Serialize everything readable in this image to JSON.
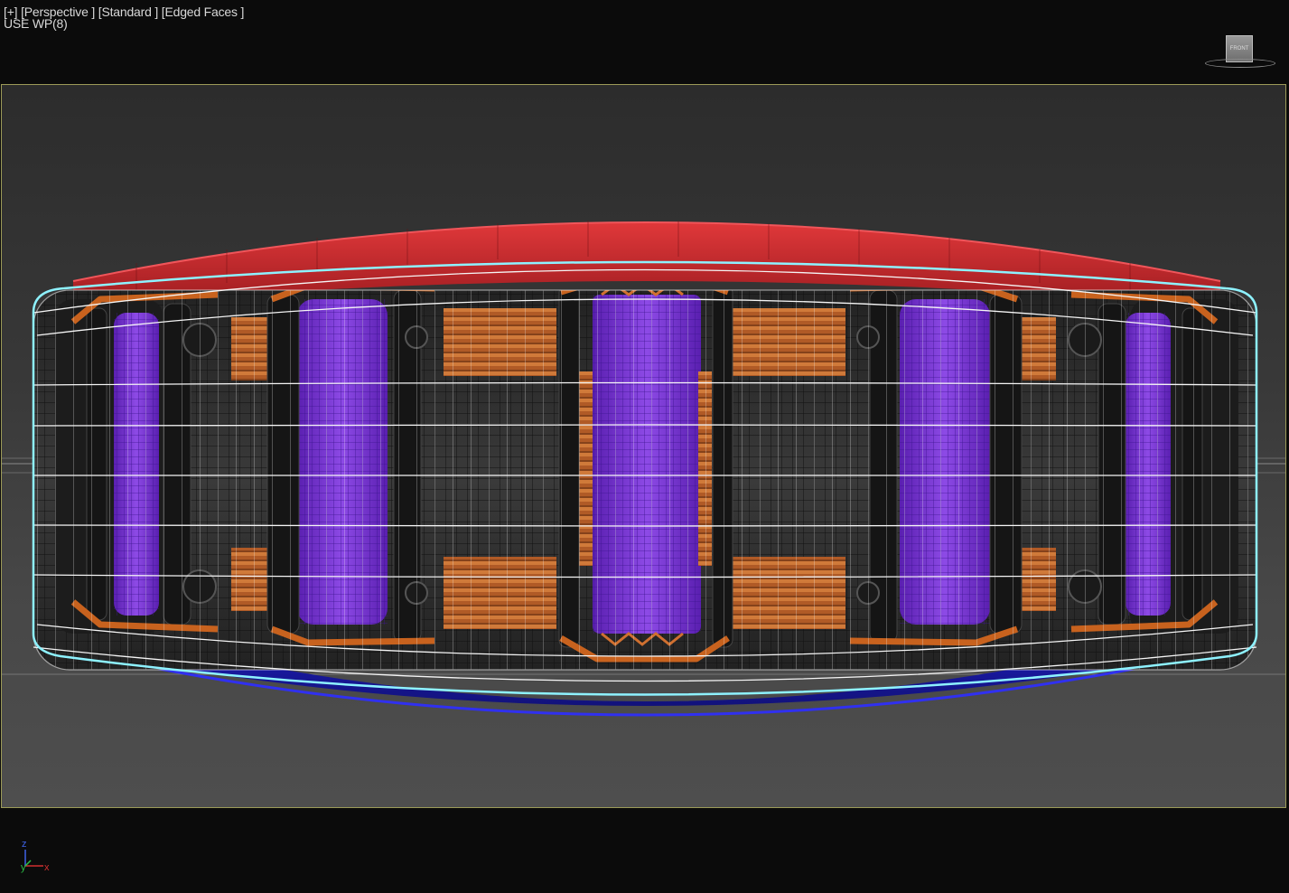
{
  "viewport": {
    "menu": [
      "[+]",
      "[Perspective ]",
      "[Standard ]",
      "[Edged Faces ]"
    ],
    "workplane_label": "USE WP(8)",
    "viewcube_face": "FRONT",
    "axes": {
      "z": "z",
      "y": "y",
      "x": "x"
    }
  },
  "colors": {
    "top_cap": "#c5262a",
    "bottom_cap": "#2020c8",
    "magnet": "#7a3cd8",
    "copper": "#c4652a",
    "housing": "#2a2a2a",
    "wire_cage": "#ffffff",
    "outline_highlight": "#8ef2ff",
    "safe_frame": "#9c9a58"
  },
  "icons": [
    "viewcube-icon",
    "axis-tripod-icon"
  ]
}
